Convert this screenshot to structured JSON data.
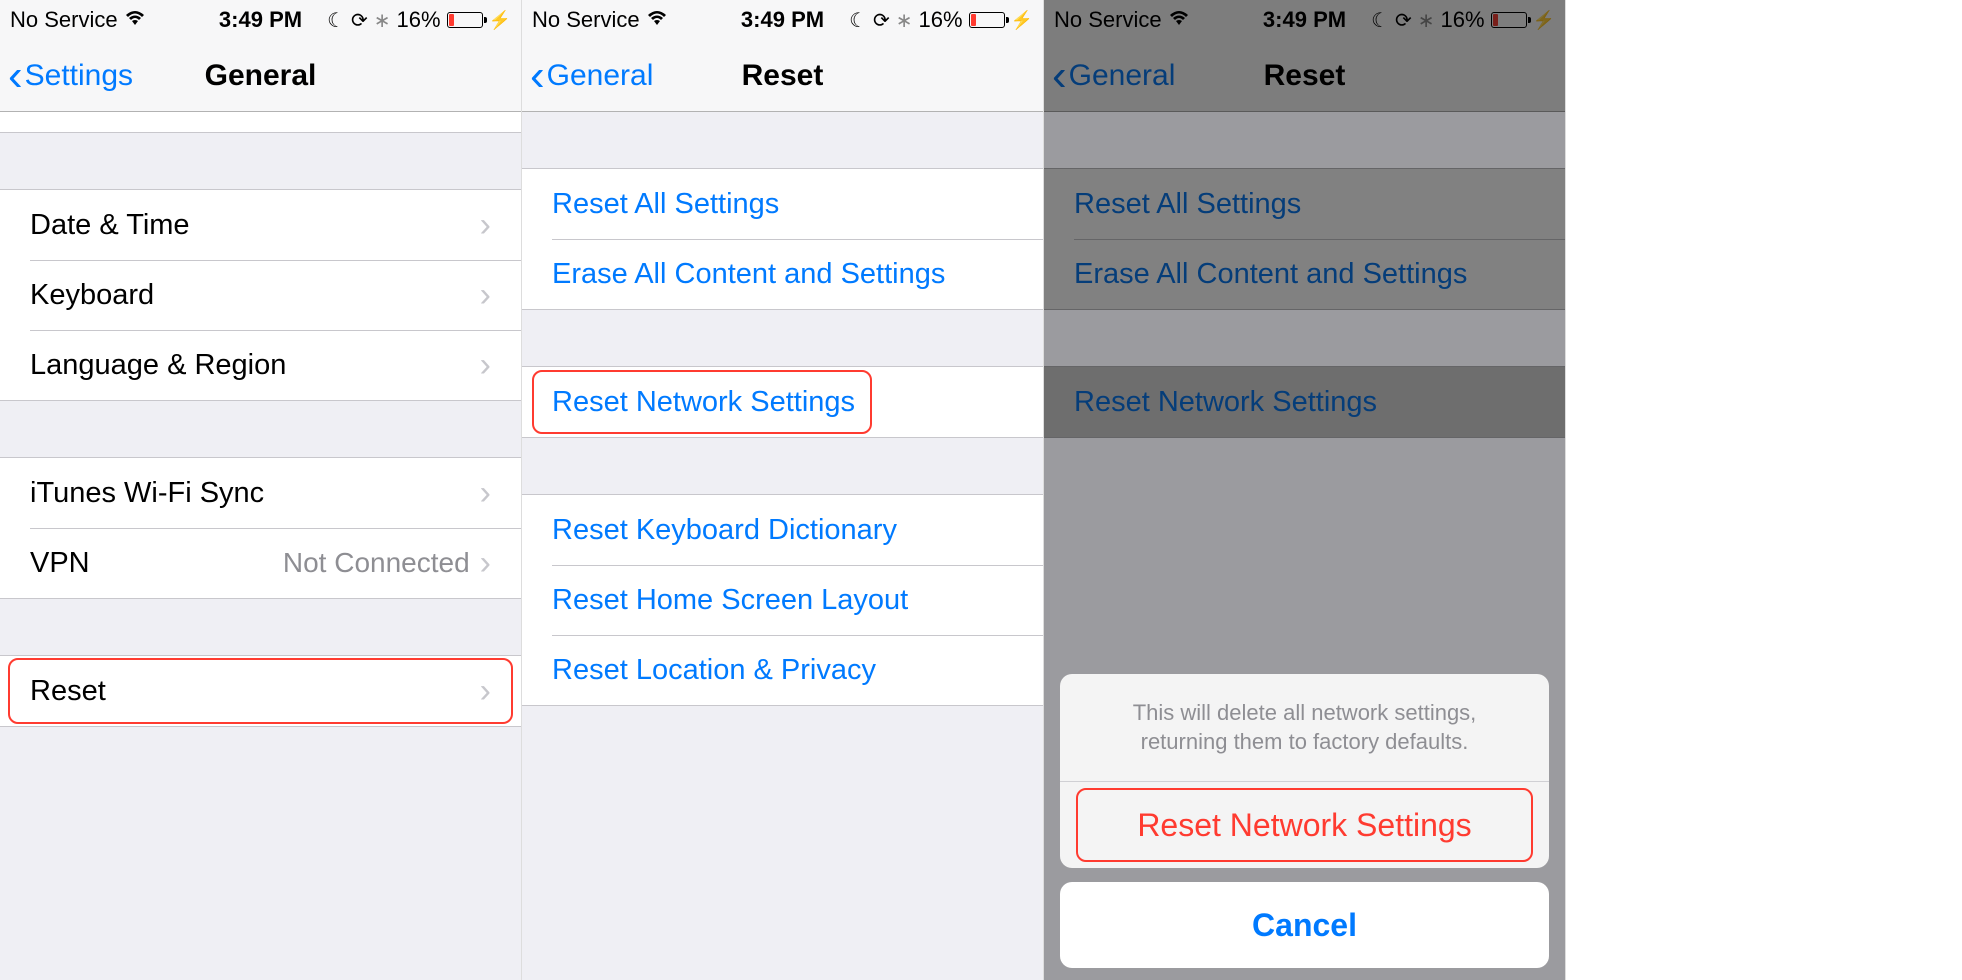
{
  "statusbar": {
    "carrier": "No Service",
    "time": "3:49 PM",
    "battery_pct": "16%"
  },
  "screen1": {
    "back_label": "Settings",
    "title": "General",
    "rows": {
      "date_time": "Date & Time",
      "keyboard": "Keyboard",
      "language_region": "Language & Region",
      "itunes_wifi_sync": "iTunes Wi-Fi Sync",
      "vpn": "VPN",
      "vpn_value": "Not Connected",
      "reset": "Reset"
    }
  },
  "screen2": {
    "back_label": "General",
    "title": "Reset",
    "rows": {
      "reset_all": "Reset All Settings",
      "erase_all": "Erase All Content and Settings",
      "reset_network": "Reset Network Settings",
      "reset_keyboard": "Reset Keyboard Dictionary",
      "reset_home": "Reset Home Screen Layout",
      "reset_location": "Reset Location & Privacy"
    }
  },
  "screen3": {
    "back_label": "General",
    "title": "Reset",
    "rows": {
      "reset_all": "Reset All Settings",
      "erase_all": "Erase All Content and Settings",
      "reset_network": "Reset Network Settings"
    },
    "sheet": {
      "message": "This will delete all network settings, returning them to factory defaults.",
      "destructive": "Reset Network Settings",
      "cancel": "Cancel"
    }
  }
}
